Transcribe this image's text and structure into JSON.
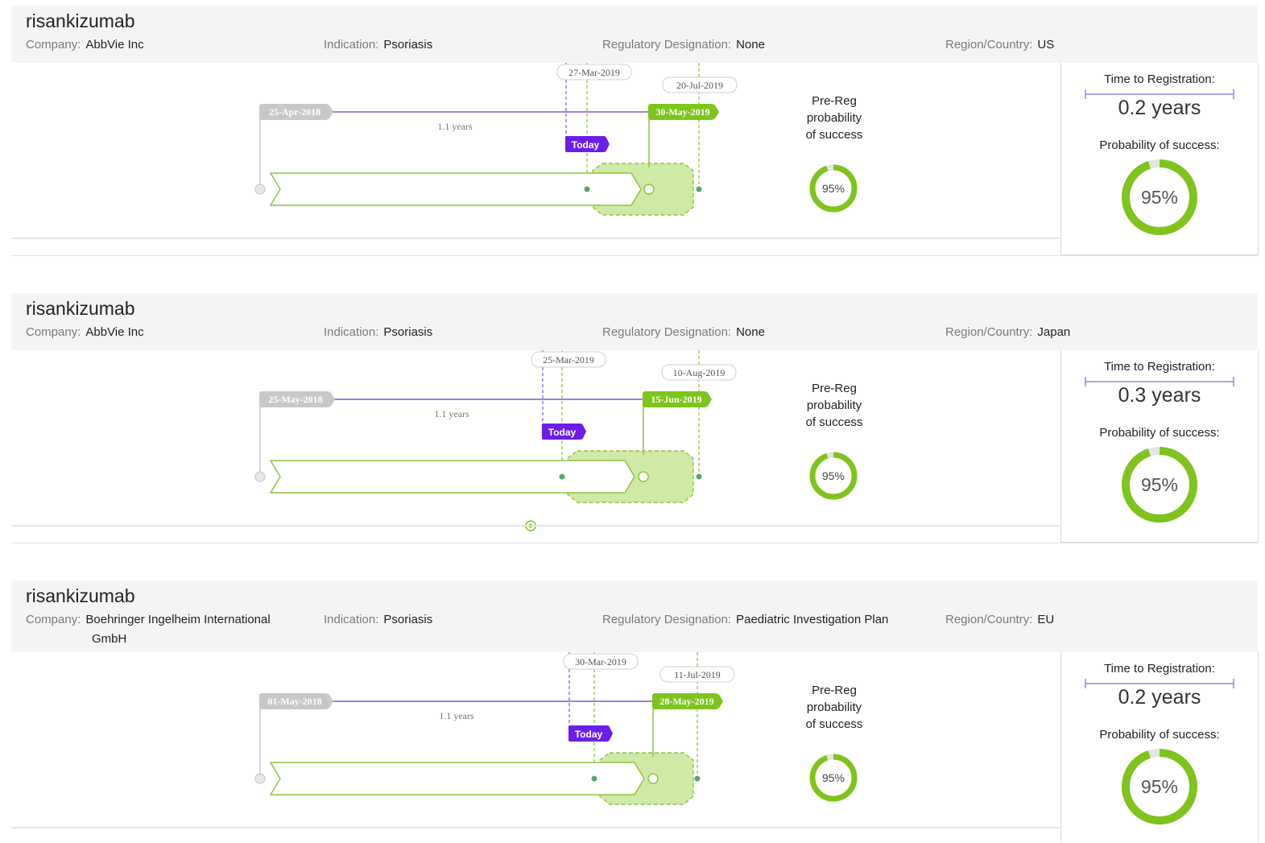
{
  "labels": {
    "company": "Company:",
    "indication": "Indication:",
    "regulatory": "Regulatory Designation:",
    "region": "Region/Country:",
    "pre_reg_line1": "Pre-Reg",
    "pre_reg_line2": "probability",
    "pre_reg_line3": "of success",
    "time_to_registration": "Time to Registration:",
    "probability_of_success": "Probability of success:",
    "today": "Today"
  },
  "colors": {
    "accent_green": "#7ec41c",
    "today_purple": "#6a1ee8",
    "timeline_purple": "#a07fe8",
    "start_gray": "#c8c8c8"
  },
  "cards": [
    {
      "name": "risankizumab",
      "company": "AbbVie Inc",
      "company_line2": "",
      "indication": "Psoriasis",
      "regulatory": "None",
      "region": "US",
      "start_date": "25-Apr-2018",
      "duration": "1.1 years",
      "today_date": "27-Mar-2019",
      "reg_date": "30-May-2019",
      "window_end_date": "20-Jul-2019",
      "pre_reg_pos": "95%",
      "pre_reg_value": 0.95,
      "time_to_reg": "0.2 years",
      "pos": "95%",
      "pos_value": 0.95
    },
    {
      "name": "risankizumab",
      "company": "AbbVie Inc",
      "company_line2": "",
      "indication": "Psoriasis",
      "regulatory": "None",
      "region": "Japan",
      "start_date": "25-May-2018",
      "duration": "1.1 years",
      "today_date": "25-Mar-2019",
      "reg_date": "15-Jun-2019",
      "window_end_date": "10-Aug-2019",
      "pre_reg_pos": "95%",
      "pre_reg_value": 0.95,
      "time_to_reg": "0.3 years",
      "pos": "95%",
      "pos_value": 0.95
    },
    {
      "name": "risankizumab",
      "company": "Boehringer Ingelheim International",
      "company_line2": "GmbH",
      "indication": "Psoriasis",
      "regulatory": "Paediatric Investigation Plan",
      "region": "EU",
      "start_date": "01-May-2018",
      "duration": "1.1 years",
      "today_date": "30-Mar-2019",
      "reg_date": "28-May-2019",
      "window_end_date": "11-Jul-2019",
      "pre_reg_pos": "95%",
      "pre_reg_value": 0.95,
      "time_to_reg": "0.2 years",
      "pos": "95%",
      "pos_value": 0.95
    }
  ]
}
